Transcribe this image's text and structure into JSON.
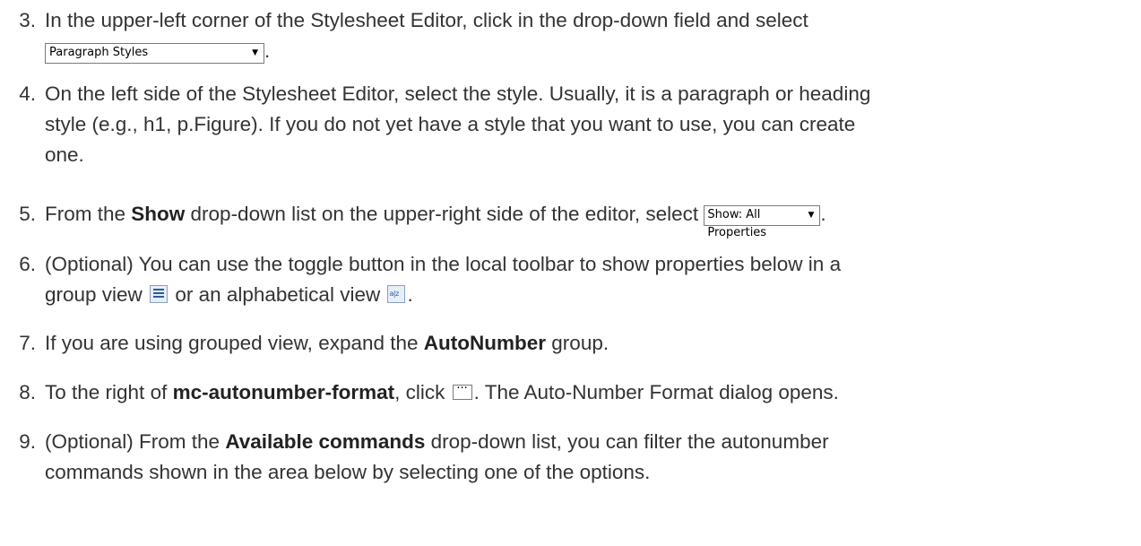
{
  "steps": [
    {
      "num": "3.",
      "text_a": "In the upper-left corner of the Stylesheet Editor, click in the drop-down field and select",
      "dropdown": "Paragraph Styles",
      "text_b": "."
    },
    {
      "num": "4.",
      "line1": "On the left side of the Stylesheet Editor, select the style. Usually, it is a paragraph or heading",
      "line2": "style (e.g., h1, p.Figure). If you do not yet have a style that you want to use, you can create",
      "line3": "one."
    },
    {
      "num": "5.",
      "text_a": "From the ",
      "bold": "Show",
      "text_b": " drop-down list on the upper-right side of the editor, select ",
      "dropdown": "Show: All Properties",
      "text_c": "."
    },
    {
      "num": "6.",
      "line1": "(Optional) You can use the toggle button in the local toolbar to show properties below in a",
      "text_a": "group view ",
      "icon1": "group-view-icon",
      "text_b": " or an alphabetical view ",
      "icon2": "alphabetical-view-icon",
      "icon2_glyph": "a|z",
      "text_c": "."
    },
    {
      "num": "7.",
      "text_a": "If you are using grouped view, expand the ",
      "bold": "AutoNumber",
      "text_b": " group."
    },
    {
      "num": "8.",
      "text_a": "To the right of ",
      "bold": "mc-autonumber-format",
      "text_b": ", click ",
      "button": "···",
      "text_c": ". The Auto-Number Format dialog opens."
    },
    {
      "num": "9.",
      "text_a": "(Optional) From the ",
      "bold": "Available commands",
      "text_b": " drop-down list, you can filter the autonumber",
      "line2": "commands shown in the area below by selecting one of the options."
    }
  ],
  "colors": {
    "text": "#333333",
    "bold": "#222222",
    "icon_blue": "#2b5d9e"
  }
}
